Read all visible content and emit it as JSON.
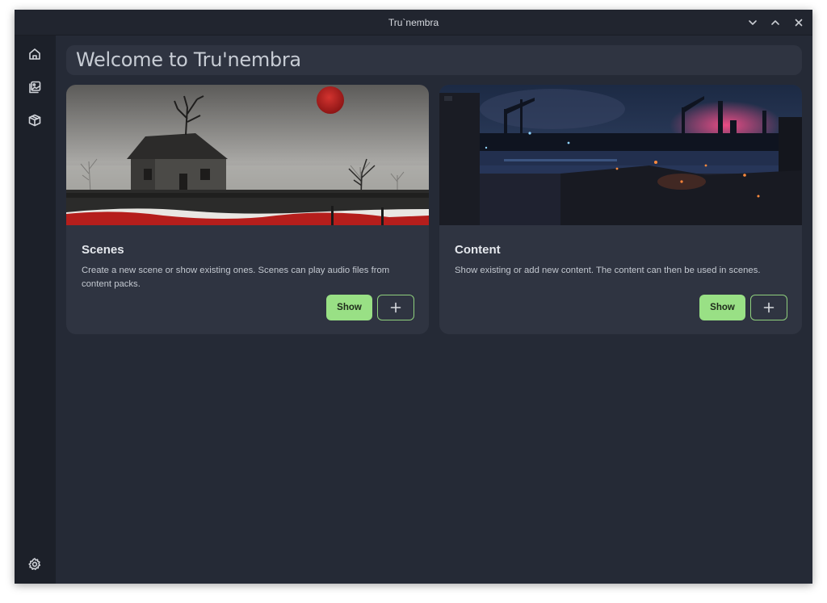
{
  "window": {
    "title": "Tru`nembra",
    "controls": [
      "chevron-down-icon",
      "chevron-up-icon",
      "close-icon"
    ]
  },
  "sidebar": {
    "items": [
      {
        "icon": "home-icon"
      },
      {
        "icon": "images-icon"
      },
      {
        "icon": "packages-icon"
      }
    ],
    "footer_icon": "gear-icon"
  },
  "main": {
    "heading": "Welcome to Tru'nembra",
    "cards": [
      {
        "title": "Scenes",
        "description": "Create a new scene or show existing ones. Scenes can play audio files from content packs.",
        "show_label": "Show",
        "add_icon": "plus-icon"
      },
      {
        "title": "Content",
        "description": "Show existing or add new content. The content can then be used in scenes.",
        "show_label": "Show",
        "add_icon": "plus-icon"
      }
    ]
  },
  "colors": {
    "background": "#252a36",
    "sidebar": "#1c2029",
    "card": "#2f3441",
    "accent_green": "#99e085",
    "text": "#e4e7ec"
  }
}
